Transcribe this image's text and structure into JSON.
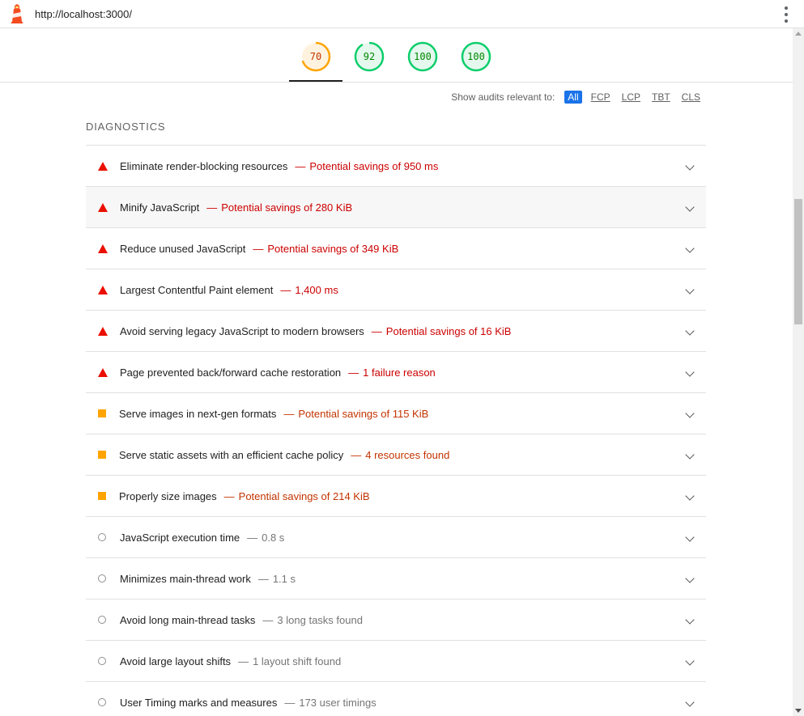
{
  "topbar": {
    "url": "http://localhost:3000/",
    "logo_icon": "lighthouse-icon",
    "menu_icon": "more-vert-icon"
  },
  "gauges": [
    {
      "score": "70",
      "value": 0.7,
      "color": "#ffa400",
      "bg": "#fff3e0",
      "text_color": "#c33300"
    },
    {
      "score": "92",
      "value": 0.92,
      "color": "#0cce6b",
      "bg": "#e5f8ee",
      "text_color": "#008800"
    },
    {
      "score": "100",
      "value": 1.0,
      "color": "#0cce6b",
      "bg": "#e5f8ee",
      "text_color": "#008800"
    },
    {
      "score": "100",
      "value": 1.0,
      "color": "#0cce6b",
      "bg": "#e5f8ee",
      "text_color": "#008800"
    }
  ],
  "filter": {
    "label": "Show audits relevant to:",
    "options": [
      "All",
      "FCP",
      "LCP",
      "TBT",
      "CLS"
    ],
    "active": "All"
  },
  "section": {
    "title": "DIAGNOSTICS"
  },
  "audits": [
    {
      "status": "fail",
      "title": "Eliminate render-blocking resources",
      "display": "Potential savings of 950 ms"
    },
    {
      "status": "fail",
      "title": "Minify JavaScript",
      "display": "Potential savings of 280 KiB"
    },
    {
      "status": "fail",
      "title": "Reduce unused JavaScript",
      "display": "Potential savings of 349 KiB"
    },
    {
      "status": "fail",
      "title": "Largest Contentful Paint element",
      "display": "1,400 ms"
    },
    {
      "status": "fail",
      "title": "Avoid serving legacy JavaScript to modern browsers",
      "display": "Potential savings of 16 KiB"
    },
    {
      "status": "fail",
      "title": "Page prevented back/forward cache restoration",
      "display": "1 failure reason"
    },
    {
      "status": "average",
      "title": "Serve images in next-gen formats",
      "display": "Potential savings of 115 KiB"
    },
    {
      "status": "average",
      "title": "Serve static assets with an efficient cache policy",
      "display": "4 resources found"
    },
    {
      "status": "average",
      "title": "Properly size images",
      "display": "Potential savings of 214 KiB"
    },
    {
      "status": "info",
      "title": "JavaScript execution time",
      "display": "0.8 s"
    },
    {
      "status": "info",
      "title": "Minimizes main-thread work",
      "display": "1.1 s"
    },
    {
      "status": "info",
      "title": "Avoid long main-thread tasks",
      "display": "3 long tasks found"
    },
    {
      "status": "info",
      "title": "Avoid large layout shifts",
      "display": "1 layout shift found"
    },
    {
      "status": "info",
      "title": "User Timing marks and measures",
      "display": "173 user timings"
    }
  ],
  "separator": "—"
}
